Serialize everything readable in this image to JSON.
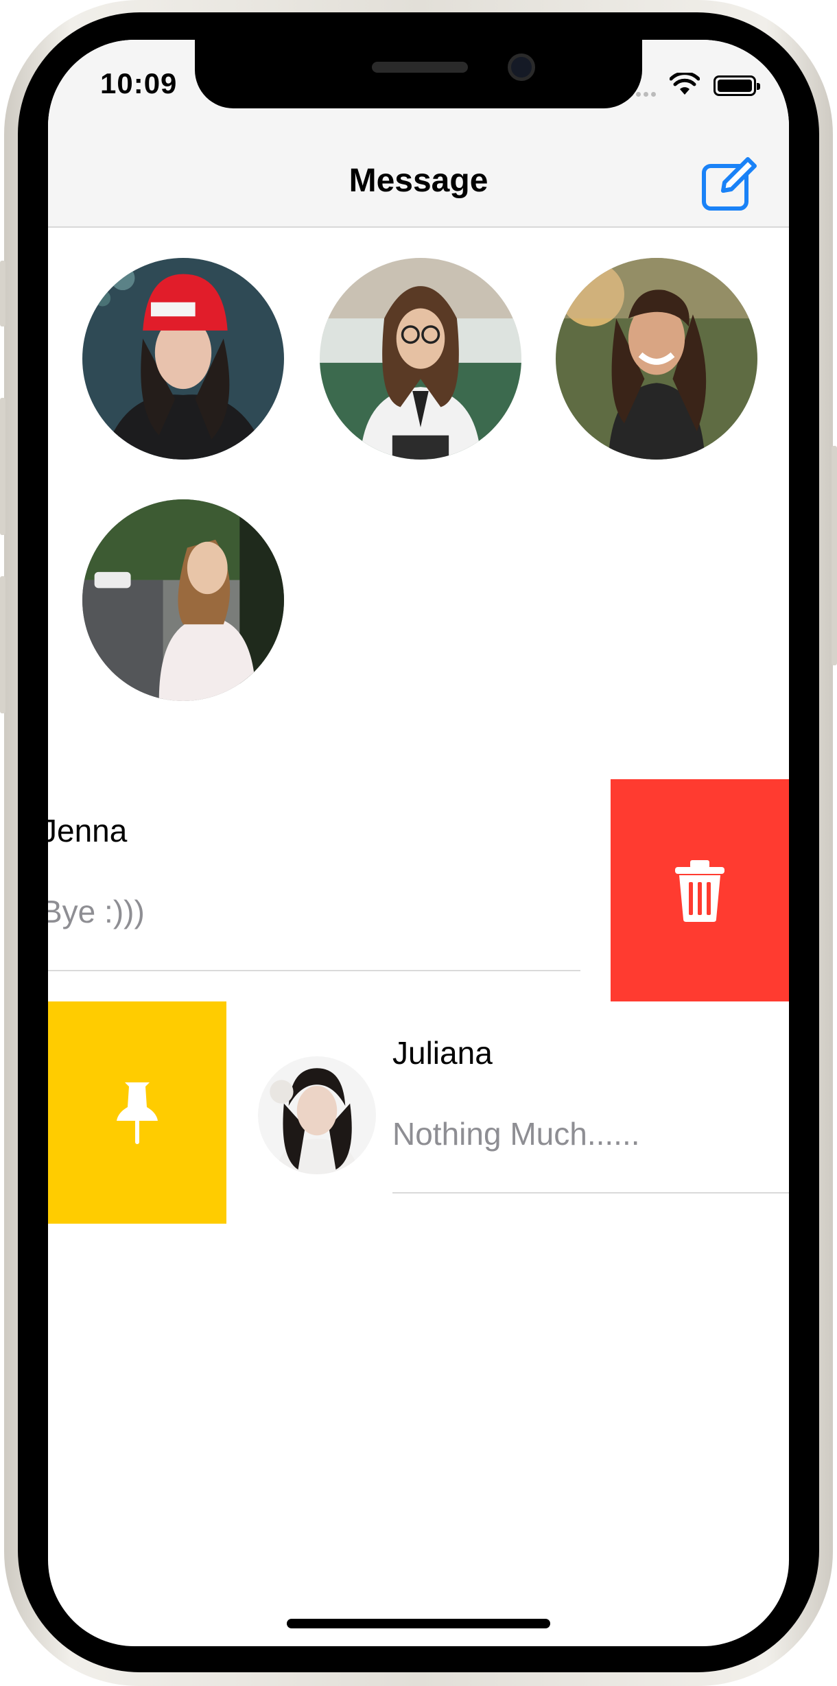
{
  "status_bar": {
    "time": "10:09",
    "wifi_icon": "wifi-icon",
    "battery_icon": "battery-full-icon"
  },
  "nav": {
    "title": "Message",
    "compose_icon": "compose-icon",
    "accent_color": "#1a82f7"
  },
  "avatars": [
    {
      "name": "avatar-1",
      "description": "woman-red-beanie"
    },
    {
      "name": "avatar-2",
      "description": "woman-glasses-school-uniform"
    },
    {
      "name": "avatar-3",
      "description": "woman-laughing-field"
    },
    {
      "name": "avatar-4",
      "description": "woman-white-tshirt-street"
    }
  ],
  "conversations": [
    {
      "name": "Jenna",
      "last_message": "Bye :)))",
      "swipe_action": {
        "icon": "trash-icon",
        "color": "#ff3b30"
      }
    },
    {
      "name": "Juliana",
      "last_message": "Nothing Much......",
      "swipe_action": {
        "icon": "pin-icon",
        "color": "#ffcc00"
      }
    }
  ]
}
